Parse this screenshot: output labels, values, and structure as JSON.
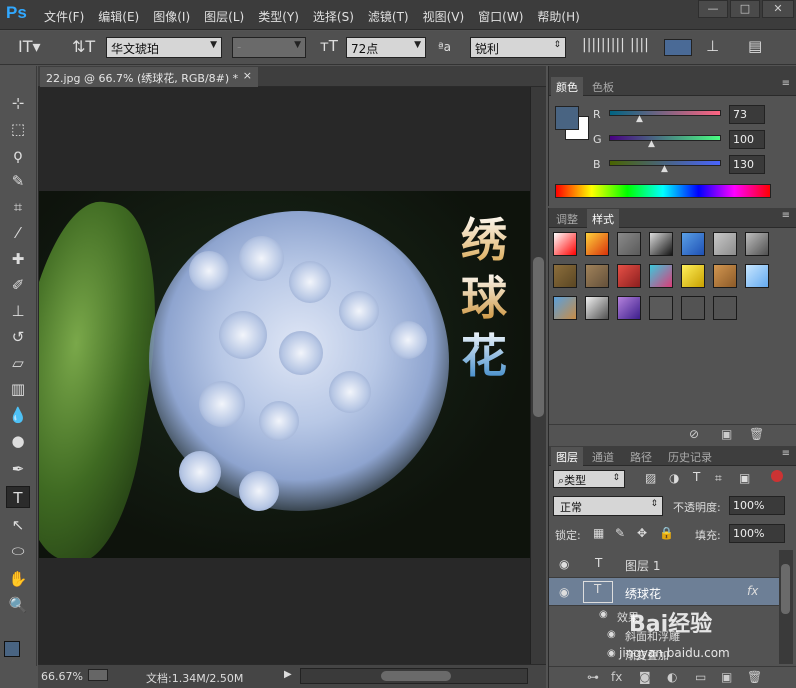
{
  "app": {
    "logo": "Ps"
  },
  "menu": [
    "文件(F)",
    "编辑(E)",
    "图像(I)",
    "图层(L)",
    "类型(Y)",
    "选择(S)",
    "滤镜(T)",
    "视图(V)",
    "窗口(W)",
    "帮助(H)"
  ],
  "window_controls": {
    "minimize": "—",
    "maximize": "□",
    "close": "✕"
  },
  "options": {
    "font_family": "华文琥珀",
    "font_style": "-",
    "font_size": "72点",
    "aa_label": "ªa",
    "antialias": "锐利",
    "text_color": "#4a6a96"
  },
  "document": {
    "tab_title": "22.jpg @ 66.7% (绣球花, RGB/8#) *",
    "close": "×",
    "overlay_chars": [
      "绣",
      "球",
      "花"
    ]
  },
  "status": {
    "zoom": "66.67%",
    "doc_info": "文档:1.34M/2.50M"
  },
  "color_panel": {
    "tabs": [
      "颜色",
      "色板"
    ],
    "R": {
      "label": "R",
      "value": "73"
    },
    "G": {
      "label": "G",
      "value": "100"
    },
    "B": {
      "label": "B",
      "value": "130"
    },
    "foreground": "#496482",
    "background": "#ffffff"
  },
  "styles_panel": {
    "tabs": [
      "调整",
      "样式"
    ],
    "styles": [
      {
        "c1": "#ffffff",
        "c2": "#ff0000"
      },
      {
        "c1": "#ffd23c",
        "c2": "#d8320a"
      },
      {
        "c1": "#8a8a8a",
        "c2": "#5a5a5a"
      },
      {
        "c1": "#dcdcdc",
        "c2": "#141414"
      },
      {
        "c1": "#5aa0e6",
        "c2": "#1e50b4"
      },
      {
        "c1": "#c8c8c8",
        "c2": "#8c8c8c"
      },
      {
        "c1": "#bebebe",
        "c2": "#505050"
      },
      {
        "c1": "#8c6e3c",
        "c2": "#5a4623"
      },
      {
        "c1": "#a0825a",
        "c2": "#64503a"
      },
      {
        "c1": "#e65046",
        "c2": "#8c1e1e"
      },
      {
        "c1": "#3cc8dc",
        "c2": "#dc3c78"
      },
      {
        "c1": "#fff05a",
        "c2": "#c8a000"
      },
      {
        "c1": "#d29650",
        "c2": "#8c5a28"
      },
      {
        "c1": "#c8e6ff",
        "c2": "#64aaf0"
      },
      {
        "c1": "#5aa0dc",
        "c2": "#c88c46"
      },
      {
        "c1": "#f0f0f0",
        "c2": "#505050"
      },
      {
        "c1": "#b482dc",
        "c2": "#3c1e8c"
      },
      {
        "c1": "#5a5a5a",
        "c2": "#5a5a5a"
      },
      {
        "c1": "#535353",
        "c2": "#535353"
      },
      {
        "c1": "#535353",
        "c2": "#535353"
      }
    ]
  },
  "layers_panel": {
    "tabs": [
      "图层",
      "通道",
      "路径",
      "历史记录"
    ],
    "filter_label": "类型",
    "blend_mode": "正常",
    "opacity_label": "不透明度:",
    "opacity": "100%",
    "lock_label": "锁定:",
    "fill_label": "填充:",
    "fill": "100%",
    "layers": [
      {
        "name": "图层 1",
        "thumb": "T",
        "selected": false
      },
      {
        "name": "绣球花",
        "thumb": "T",
        "selected": true,
        "fx": "fx"
      }
    ],
    "effects_label": "效果",
    "effects": [
      "斜面和浮雕",
      "渐变叠加"
    ]
  },
  "watermark": {
    "text": "Bai经验",
    "url": "jingyan.baidu.com"
  }
}
